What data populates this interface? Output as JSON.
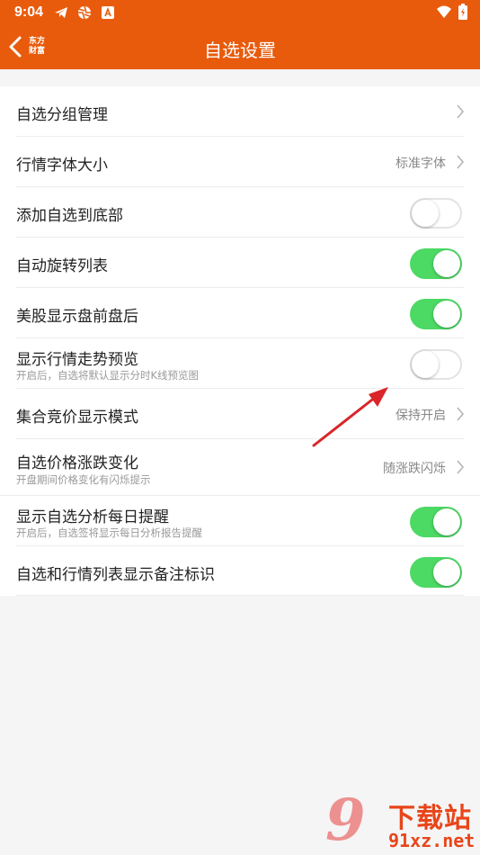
{
  "status_bar": {
    "time": "9:04",
    "icons_left": [
      "telegram-icon",
      "aperture-icon",
      "a-box-icon"
    ],
    "icons_right": [
      "wifi-icon",
      "battery-icon"
    ]
  },
  "header": {
    "back_icon": "chevron-left-icon",
    "logo_line1": "东方",
    "logo_line2": "财富",
    "title": "自选设置"
  },
  "settings": [
    {
      "label": "自选分组管理",
      "control": "chevron"
    },
    {
      "label": "行情字体大小",
      "value": "标准字体",
      "control": "chevron"
    },
    {
      "label": "添加自选到底部",
      "control": "toggle",
      "on": false
    },
    {
      "label": "自动旋转列表",
      "control": "toggle",
      "on": true
    },
    {
      "label": "美股显示盘前盘后",
      "control": "toggle",
      "on": true
    },
    {
      "label": "显示行情走势预览",
      "sub": "开启后，自选将默认显示分时K线预览图",
      "control": "toggle",
      "on": false
    },
    {
      "label": "集合竞价显示模式",
      "value": "保持开启",
      "control": "chevron"
    },
    {
      "label": "自选价格涨跌变化",
      "sub": "开盘期间价格变化有闪烁提示",
      "value": "随涨跌闪烁",
      "control": "chevron"
    },
    {
      "label": "显示自选分析每日提醒",
      "sub": "开启后，自选签将显示每日分析报告提醒",
      "control": "toggle",
      "on": true
    },
    {
      "label": "自选和行情列表显示备注标识",
      "control": "toggle",
      "on": true
    }
  ],
  "watermark": {
    "mark": "9",
    "text": "下载站",
    "url": "91xz.net"
  },
  "colors": {
    "header_bg": "#e85b0c",
    "toggle_on": "#4cd964",
    "annotation_arrow": "#d9262a"
  }
}
